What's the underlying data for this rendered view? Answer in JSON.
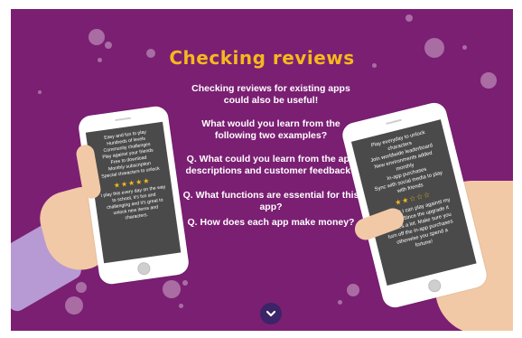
{
  "title": "Checking reviews",
  "questions": [
    "Checking reviews for existing apps could also be useful!",
    "What would you learn from the following two examples?",
    "Q. What could you learn from the app descriptions and customer feedback?",
    "Q. What functions are essential for this app?",
    "Q. How does each app make money?"
  ],
  "left_phone": {
    "features": [
      "Easy and fun to play",
      "Hundreds of levels",
      "Community challenges",
      "Play against your friends",
      "Free to download",
      "Monthly subscription",
      "Special characters to unlock"
    ],
    "stars": "★★★★★",
    "review": [
      "I play this every day on the way",
      "to school, it's fun and",
      "challenging and it's great to",
      "unlock new items and",
      "characters."
    ]
  },
  "right_phone": {
    "features": [
      "Play everyday to unlock",
      "characters",
      "Join worldwide leaderboard",
      "New environments added",
      "monthly",
      "In-app purchases",
      "Sync with social media to play",
      "with friends"
    ],
    "stars": "★★☆☆☆",
    "review": [
      "I like that I can play against my",
      "friends. Since the upgrade it",
      "crashes a lot. Make sure you",
      "turn off the in-app purchases",
      "otherwise you spend a",
      "fortune!"
    ]
  },
  "colors": {
    "background": "#7b1f73",
    "title": "#f6b81c",
    "screen": "#4a4a4a",
    "button": "#3b2467"
  },
  "icons": {
    "scroll_down": "chevron-down-icon"
  }
}
